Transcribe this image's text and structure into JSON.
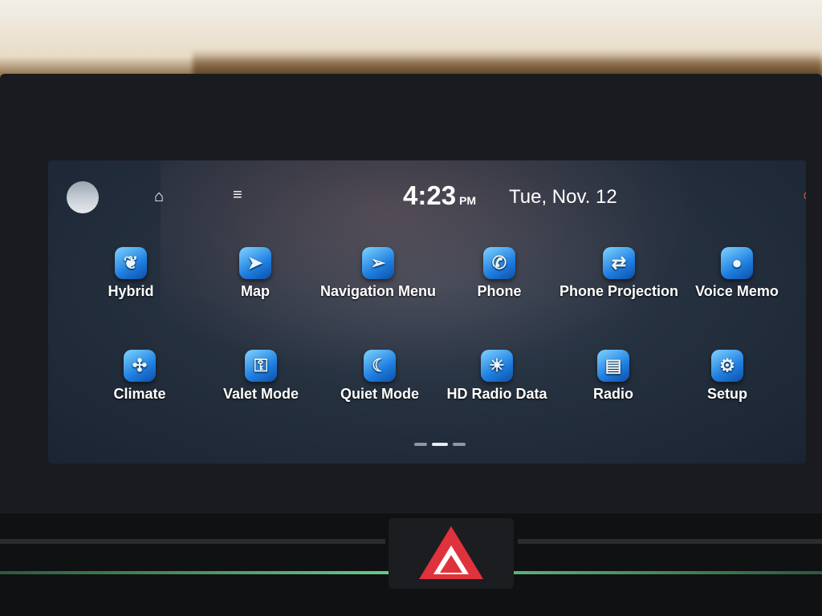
{
  "status_bar": {
    "time": "4:23",
    "ampm": "PM",
    "date": "Tue, Nov. 12",
    "icons": [
      "profile-avatar",
      "home-icon",
      "menu-icon",
      "bluetooth-status-icon"
    ]
  },
  "apps": [
    {
      "label": "Hybrid",
      "icon": "leaf-icon",
      "glyph": "❦"
    },
    {
      "label": "Map",
      "icon": "map-icon",
      "glyph": "➤"
    },
    {
      "label": "Navigation Menu",
      "icon": "navigation-icon",
      "glyph": "➢"
    },
    {
      "label": "Phone",
      "icon": "phone-icon",
      "glyph": "✆"
    },
    {
      "label": "Phone Projection",
      "icon": "phone-projection-icon",
      "glyph": "⇄"
    },
    {
      "label": "Voice Memo",
      "icon": "voice-memo-icon",
      "glyph": "●"
    },
    {
      "label": "Climate",
      "icon": "fan-icon",
      "glyph": "✣"
    },
    {
      "label": "Valet Mode",
      "icon": "valet-icon",
      "glyph": "⚿"
    },
    {
      "label": "Quiet Mode",
      "icon": "quiet-mode-icon",
      "glyph": "☾"
    },
    {
      "label": "HD Radio Data",
      "icon": "hd-radio-data-icon",
      "glyph": "☀"
    },
    {
      "label": "Radio",
      "icon": "radio-icon",
      "glyph": "▤"
    },
    {
      "label": "Setup",
      "icon": "gear-icon",
      "glyph": "⚙"
    }
  ],
  "pager": {
    "pages": 3,
    "current": 2
  },
  "colors": {
    "screen_bg": "#263140",
    "icon_blue": "#1f7ee0",
    "hazard_red": "#e0323c",
    "ambient_green": "#6bd08a"
  }
}
